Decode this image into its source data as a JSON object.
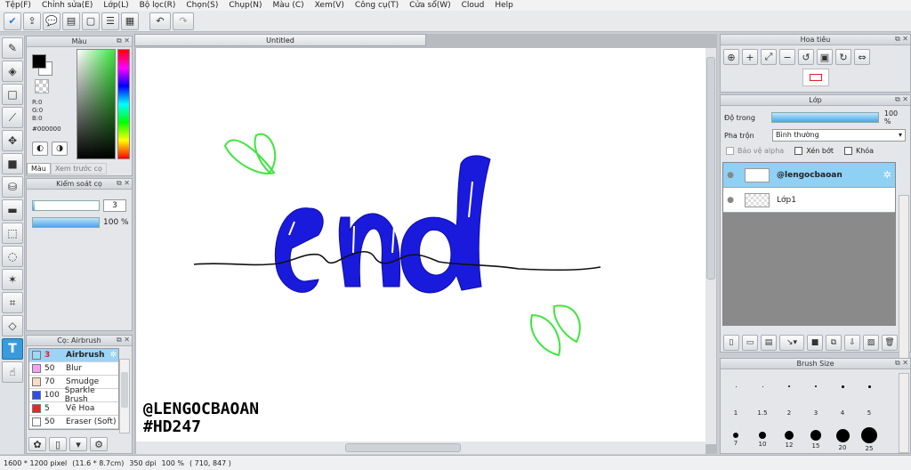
{
  "menu": [
    "Tệp(F)",
    "Chỉnh sửa(E)",
    "Lớp(L)",
    "Bộ lọc(R)",
    "Chọn(S)",
    "Chụp(N)",
    "Màu (C)",
    "Xem(V)",
    "Công cụ(T)",
    "Cửa sổ(W)",
    "Cloud",
    "Help"
  ],
  "color_panel": {
    "title": "Màu",
    "r": "R:0",
    "g": "G:0",
    "b": "B:0",
    "hex": "#000000",
    "tab_color": "Màu",
    "tab_preview": "Xem trước cọ"
  },
  "control_panel": {
    "title": "Kiểm soát cọ",
    "size_value": "3",
    "opacity_label": "100 %"
  },
  "brush_panel": {
    "title": "Cọ: Airbrush",
    "items": [
      {
        "size": "3",
        "name": "Airbrush",
        "color": "#a7d3f5"
      },
      {
        "size": "50",
        "name": "Blur",
        "color": "#f4a0f4"
      },
      {
        "size": "70",
        "name": "Smudge",
        "color": "#f8dcc4"
      },
      {
        "size": "100",
        "name": "Sparkle Brush",
        "color": "#2f4fe0"
      },
      {
        "size": "5",
        "name": "Vẽ Hoa",
        "color": "#e12a2a"
      },
      {
        "size": "50",
        "name": "Eraser (Soft)",
        "color": "#ffffff"
      }
    ]
  },
  "document": {
    "tab": "Untitled",
    "watermark1": "@LENGOCBAOAN",
    "watermark2": "#HD247"
  },
  "navigator": {
    "title": "Hoa tiêu"
  },
  "layers": {
    "title": "Lớp",
    "opacity_label": "Độ trong",
    "opacity_value": "100 %",
    "blend_label": "Pha trộn",
    "blend_value": "Bình thường",
    "protect_alpha": "Bảo vệ alpha",
    "clip": "Xén bớt",
    "lock": "Khóa",
    "items": [
      {
        "name": "@lengocbaoan"
      },
      {
        "name": "Lớp1"
      }
    ]
  },
  "brush_size": {
    "title": "Brush Size",
    "row1": [
      "1",
      "1.5",
      "2",
      "3",
      "4",
      "5"
    ],
    "row2": [
      "7",
      "10",
      "12",
      "15",
      "20",
      "25"
    ]
  },
  "status": {
    "size": "1600 * 1200 pixel",
    "dims": "(11.6 * 8.7cm)",
    "dpi": "350 dpi",
    "zoom": "100 %",
    "coords": "( 710, 847 )"
  },
  "colors": {
    "accent": "#3a9bdc",
    "text_blue": "#1a1adc",
    "leaf_green": "#3ee63e"
  }
}
